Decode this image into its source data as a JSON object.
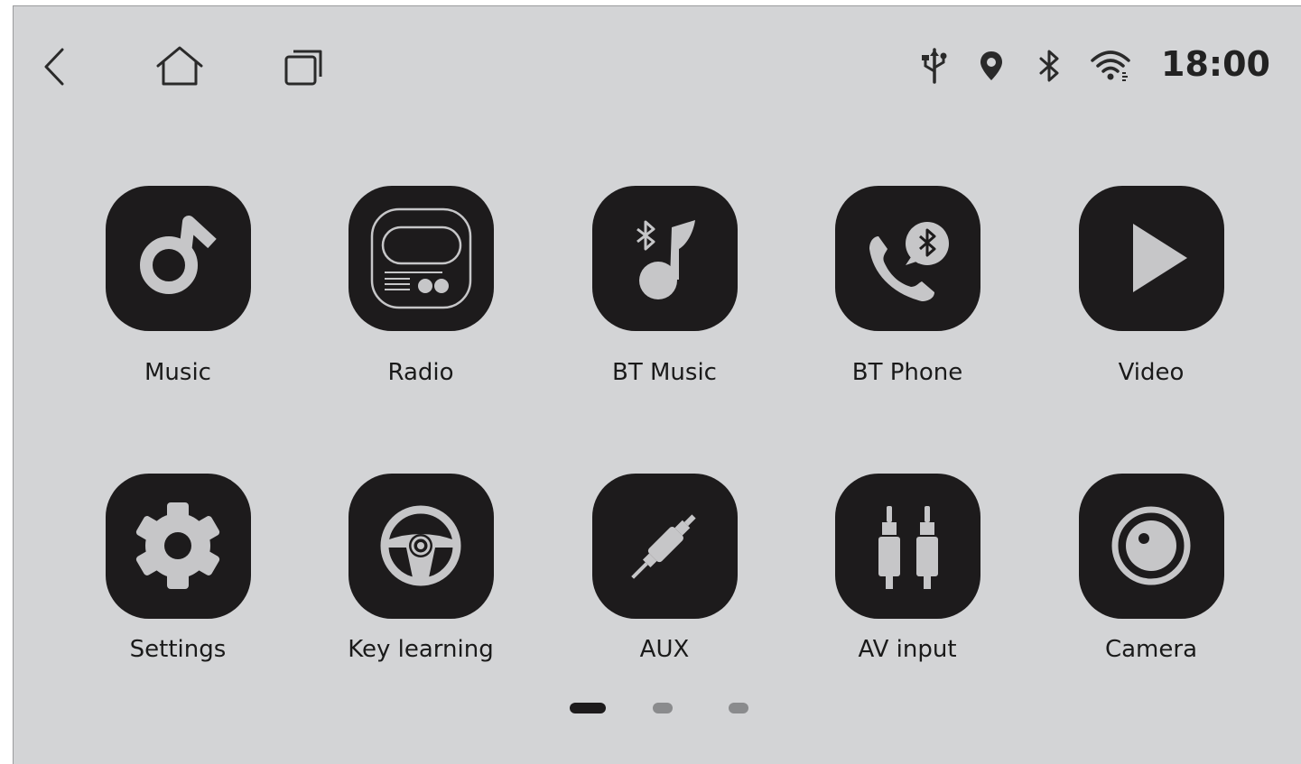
{
  "status_bar": {
    "time": "18:00",
    "icons": [
      "usb-icon",
      "location-icon",
      "bluetooth-icon",
      "wifi-icon"
    ]
  },
  "nav": {
    "icons": [
      "back-icon",
      "home-icon",
      "recent-apps-icon"
    ]
  },
  "apps": [
    {
      "label": "Music",
      "icon": "music-note-icon"
    },
    {
      "label": "Radio",
      "icon": "radio-icon"
    },
    {
      "label": "BT Music",
      "icon": "bluetooth-music-icon"
    },
    {
      "label": "BT Phone",
      "icon": "bluetooth-phone-icon"
    },
    {
      "label": "Video",
      "icon": "play-icon"
    },
    {
      "label": "Settings",
      "icon": "gear-icon"
    },
    {
      "label": "Key learning",
      "icon": "steering-wheel-icon"
    },
    {
      "label": "AUX",
      "icon": "aux-plug-icon"
    },
    {
      "label": "AV input",
      "icon": "rca-plugs-icon"
    },
    {
      "label": "Camera",
      "icon": "camera-lens-icon"
    }
  ],
  "pager": {
    "pages": 3,
    "current": 1
  },
  "colors": {
    "background": "#d3d4d6",
    "tile": "#1d1b1c",
    "icon_fill": "#c6c6c8",
    "text": "#1a1a1a",
    "dot_inactive": "#8a8b8d"
  }
}
